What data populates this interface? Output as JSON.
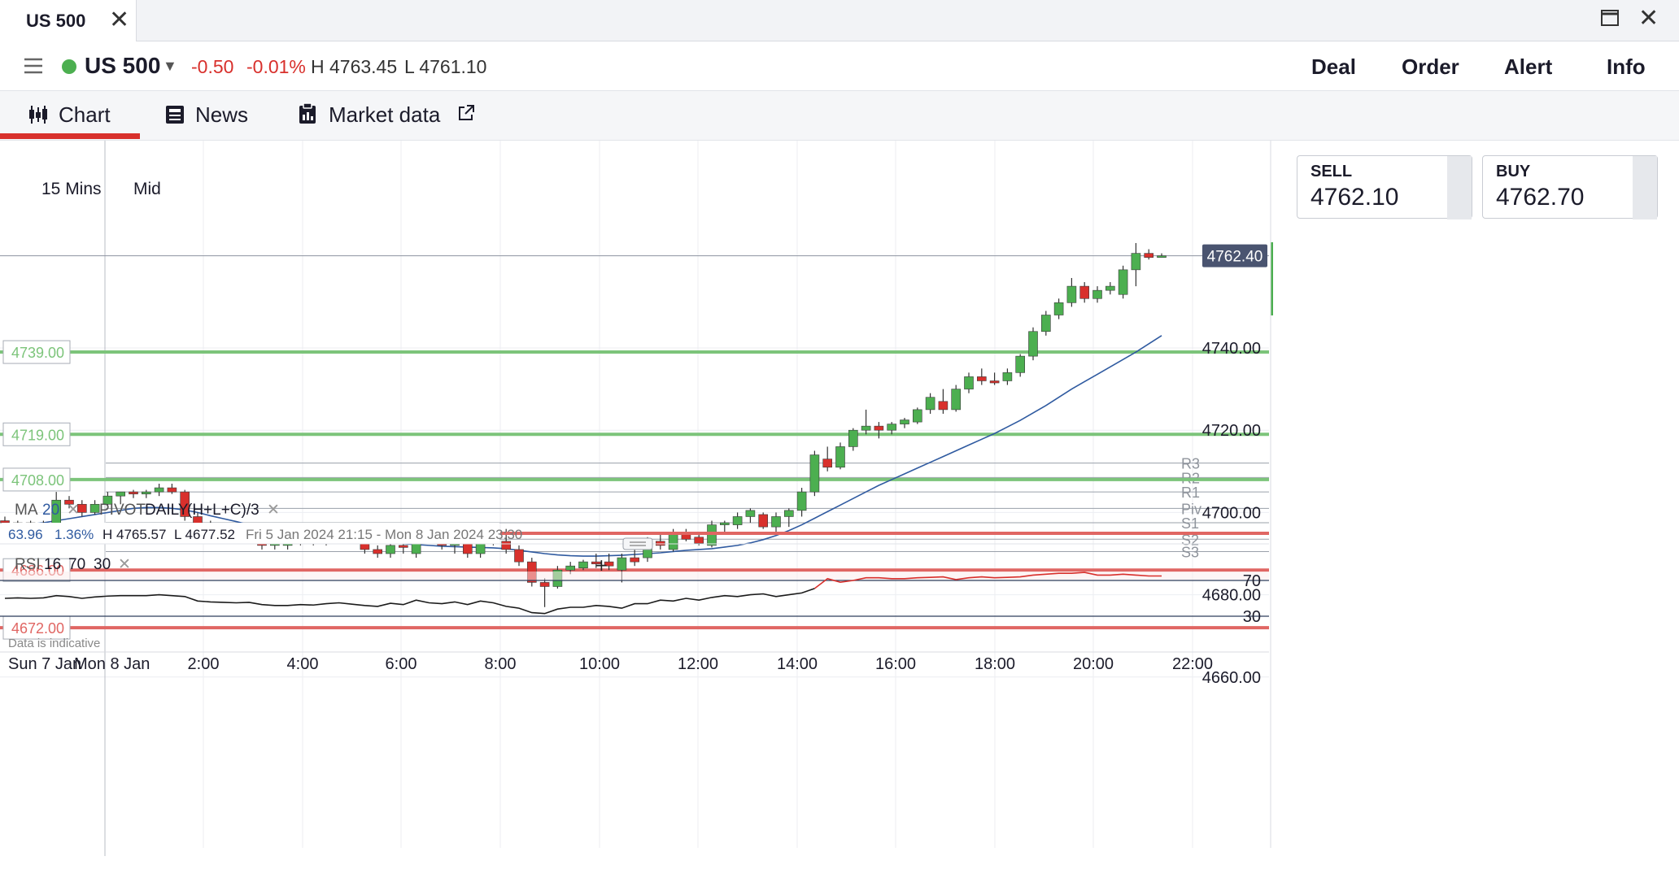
{
  "window": {
    "tab_title": "US 500"
  },
  "header": {
    "symbol": "US 500",
    "change": "-0.50",
    "change_pct": "-0.01%",
    "high": "H 4763.45",
    "low": "L 4761.10",
    "buttons": [
      "Deal",
      "Order",
      "Alert",
      "Info"
    ]
  },
  "subtabs": {
    "chart": "Chart",
    "news": "News",
    "market_data": "Market data"
  },
  "timeframe": {
    "interval": "15 Mins",
    "price_type": "Mid"
  },
  "quote": {
    "sell_label": "SELL",
    "sell": "4762.10",
    "buy_label": "BUY",
    "buy": "4762.70"
  },
  "colors": {
    "up": "#4caf50",
    "down": "#d8302c",
    "ma": "#2f5aa0",
    "last_price_bg": "#4a5470",
    "green_level": "#7cc47a",
    "red_level": "#e06663",
    "status_dot": "#4caf50"
  },
  "chart_data": {
    "type": "candlestick",
    "last_price": 4762.4,
    "last_price_label": "4762.40",
    "ylim": [
      4651,
      4776
    ],
    "y_ticks": [
      4740,
      4720,
      4700,
      4680,
      4660
    ],
    "y_tick_labels": [
      "4740.00",
      "4720.00",
      "4700.00",
      "4680.00",
      "4660.00"
    ],
    "x_tick_labels": [
      "2:00",
      "4:00",
      "6:00",
      "8:00",
      "10:00",
      "12:00",
      "14:00",
      "16:00",
      "18:00",
      "20:00",
      "22:00"
    ],
    "x_date_labels": [
      "Sun 7 Jan",
      "Mon 8 Jan"
    ],
    "level_lines": [
      {
        "label": "4739.00",
        "value": 4739,
        "kind": "resistance"
      },
      {
        "label": "4719.00",
        "value": 4719,
        "kind": "resistance"
      },
      {
        "label": "4708.00",
        "value": 4708,
        "kind": "resistance"
      },
      {
        "label": "4686.00",
        "value": 4686,
        "kind": "support"
      },
      {
        "label": "4672.00",
        "value": 4672,
        "kind": "support"
      }
    ],
    "pivots": [
      {
        "label": "R3",
        "value": 4712
      },
      {
        "label": "R2",
        "value": 4708.5
      },
      {
        "label": "R1",
        "value": 4705
      },
      {
        "label": "Piv",
        "value": 4701
      },
      {
        "label": "S1",
        "value": 4697.5
      },
      {
        "label": "S2",
        "value": 4693.5
      },
      {
        "label": "S3",
        "value": 4690.5
      }
    ],
    "candles": [
      {
        "t": "00:00",
        "o": 4698,
        "h": 4699,
        "l": 4697,
        "c": 4697.5
      },
      {
        "t": "00:15",
        "o": 4697.5,
        "h": 4698,
        "l": 4696,
        "c": 4696.5
      },
      {
        "t": "00:30",
        "o": 4697,
        "h": 4698,
        "l": 4696,
        "c": 4697.5
      },
      {
        "t": "00:45",
        "o": 4697,
        "h": 4698,
        "l": 4696.5,
        "c": 4697
      },
      {
        "t": "01:00",
        "o": 4697,
        "h": 4705,
        "l": 4696,
        "c": 4703
      },
      {
        "t": "01:15",
        "o": 4703,
        "h": 4704,
        "l": 4701,
        "c": 4702
      },
      {
        "t": "01:30",
        "o": 4702,
        "h": 4703,
        "l": 4699,
        "c": 4700
      },
      {
        "t": "01:45",
        "o": 4700,
        "h": 4703,
        "l": 4699.5,
        "c": 4702
      },
      {
        "t": "02:00",
        "o": 4702,
        "h": 4705,
        "l": 4701,
        "c": 4704
      },
      {
        "t": "02:15",
        "o": 4704,
        "h": 4705,
        "l": 4702,
        "c": 4705
      },
      {
        "t": "02:30",
        "o": 4705,
        "h": 4705.5,
        "l": 4703.5,
        "c": 4704.5
      },
      {
        "t": "02:45",
        "o": 4704.5,
        "h": 4705.5,
        "l": 4703.5,
        "c": 4705
      },
      {
        "t": "03:00",
        "o": 4705,
        "h": 4707,
        "l": 4704,
        "c": 4706
      },
      {
        "t": "03:15",
        "o": 4706,
        "h": 4707,
        "l": 4704.5,
        "c": 4705
      },
      {
        "t": "03:30",
        "o": 4705,
        "h": 4705.5,
        "l": 4698,
        "c": 4699
      },
      {
        "t": "03:45",
        "o": 4699,
        "h": 4700,
        "l": 4696,
        "c": 4697
      },
      {
        "t": "04:00",
        "o": 4697,
        "h": 4698,
        "l": 4695,
        "c": 4696
      },
      {
        "t": "04:15",
        "o": 4696,
        "h": 4697,
        "l": 4695,
        "c": 4696.5
      },
      {
        "t": "04:30",
        "o": 4696,
        "h": 4697,
        "l": 4693,
        "c": 4694
      },
      {
        "t": "04:45",
        "o": 4694,
        "h": 4695,
        "l": 4692.5,
        "c": 4693
      },
      {
        "t": "05:00",
        "o": 4693,
        "h": 4694,
        "l": 4691,
        "c": 4692
      },
      {
        "t": "05:15",
        "o": 4692,
        "h": 4693,
        "l": 4691,
        "c": 4692.5
      },
      {
        "t": "05:30",
        "o": 4692,
        "h": 4693.5,
        "l": 4691,
        "c": 4693
      },
      {
        "t": "05:45",
        "o": 4693,
        "h": 4694,
        "l": 4692,
        "c": 4693.5
      },
      {
        "t": "06:00",
        "o": 4693.5,
        "h": 4694,
        "l": 4692,
        "c": 4692.5
      },
      {
        "t": "06:15",
        "o": 4693,
        "h": 4694.5,
        "l": 4692,
        "c": 4694
      },
      {
        "t": "06:30",
        "o": 4694,
        "h": 4695,
        "l": 4693,
        "c": 4694.5
      },
      {
        "t": "06:45",
        "o": 4694.5,
        "h": 4695,
        "l": 4692.5,
        "c": 4693
      },
      {
        "t": "07:00",
        "o": 4693,
        "h": 4694,
        "l": 4690,
        "c": 4691
      },
      {
        "t": "07:15",
        "o": 4691,
        "h": 4692,
        "l": 4689,
        "c": 4690
      },
      {
        "t": "07:30",
        "o": 4690,
        "h": 4693,
        "l": 4689,
        "c": 4692
      },
      {
        "t": "07:45",
        "o": 4692,
        "h": 4693,
        "l": 4690,
        "c": 4691.5
      },
      {
        "t": "08:00",
        "o": 4690,
        "h": 4696,
        "l": 4689,
        "c": 4695
      },
      {
        "t": "08:15",
        "o": 4695,
        "h": 4696,
        "l": 4693,
        "c": 4694
      },
      {
        "t": "08:30",
        "o": 4694,
        "h": 4695,
        "l": 4691,
        "c": 4692
      },
      {
        "t": "08:45",
        "o": 4692,
        "h": 4694,
        "l": 4690,
        "c": 4693
      },
      {
        "t": "09:00",
        "o": 4693,
        "h": 4694,
        "l": 4689,
        "c": 4690
      },
      {
        "t": "09:15",
        "o": 4690,
        "h": 4695.5,
        "l": 4689,
        "c": 4695
      },
      {
        "t": "09:30",
        "o": 4695,
        "h": 4697,
        "l": 4692,
        "c": 4693
      },
      {
        "t": "09:45",
        "o": 4693,
        "h": 4696,
        "l": 4690,
        "c": 4691
      },
      {
        "t": "10:00",
        "o": 4691,
        "h": 4692,
        "l": 4687,
        "c": 4688
      },
      {
        "t": "10:15",
        "o": 4688,
        "h": 4689,
        "l": 4682,
        "c": 4683
      },
      {
        "t": "10:30",
        "o": 4683,
        "h": 4684,
        "l": 4677,
        "c": 4682
      },
      {
        "t": "10:45",
        "o": 4682,
        "h": 4687,
        "l": 4681.5,
        "c": 4686
      },
      {
        "t": "11:00",
        "o": 4686,
        "h": 4688,
        "l": 4685,
        "c": 4687
      },
      {
        "t": "11:15",
        "o": 4686.5,
        "h": 4688.5,
        "l": 4686,
        "c": 4688
      },
      {
        "t": "11:30",
        "o": 4688,
        "h": 4690,
        "l": 4686.5,
        "c": 4687.5
      },
      {
        "t": "11:45",
        "o": 4688,
        "h": 4690,
        "l": 4686,
        "c": 4687
      },
      {
        "t": "12:00",
        "o": 4686,
        "h": 4690,
        "l": 4683,
        "c": 4689
      },
      {
        "t": "12:15",
        "o": 4689,
        "h": 4691,
        "l": 4687,
        "c": 4688
      },
      {
        "t": "12:30",
        "o": 4689,
        "h": 4694,
        "l": 4688,
        "c": 4693
      },
      {
        "t": "12:45",
        "o": 4693,
        "h": 4695,
        "l": 4691,
        "c": 4692
      },
      {
        "t": "13:00",
        "o": 4691,
        "h": 4696,
        "l": 4690.5,
        "c": 4695
      },
      {
        "t": "13:15",
        "o": 4695,
        "h": 4696,
        "l": 4693,
        "c": 4693.5
      },
      {
        "t": "13:30",
        "o": 4694,
        "h": 4695,
        "l": 4692,
        "c": 4692.5
      },
      {
        "t": "13:45",
        "o": 4692,
        "h": 4698,
        "l": 4691.5,
        "c": 4697
      },
      {
        "t": "14:00",
        "o": 4697,
        "h": 4698,
        "l": 4695,
        "c": 4697.5
      },
      {
        "t": "14:15",
        "o": 4697,
        "h": 4700,
        "l": 4696,
        "c": 4699
      },
      {
        "t": "14:30",
        "o": 4699,
        "h": 4701,
        "l": 4697.5,
        "c": 4700.5
      },
      {
        "t": "14:45",
        "o": 4699.5,
        "h": 4700,
        "l": 4696,
        "c": 4696.5
      },
      {
        "t": "15:00",
        "o": 4696.5,
        "h": 4700,
        "l": 4695,
        "c": 4699
      },
      {
        "t": "15:15",
        "o": 4699,
        "h": 4701,
        "l": 4696.5,
        "c": 4700.5
      },
      {
        "t": "15:30",
        "o": 4700.5,
        "h": 4706,
        "l": 4699,
        "c": 4705
      },
      {
        "t": "15:45",
        "o": 4705,
        "h": 4715,
        "l": 4704,
        "c": 4714
      },
      {
        "t": "16:00",
        "o": 4713,
        "h": 4716,
        "l": 4710,
        "c": 4711
      },
      {
        "t": "16:15",
        "o": 4711,
        "h": 4717,
        "l": 4710.5,
        "c": 4716
      },
      {
        "t": "16:30",
        "o": 4716,
        "h": 4720.5,
        "l": 4715,
        "c": 4720
      },
      {
        "t": "16:45",
        "o": 4720,
        "h": 4725,
        "l": 4719,
        "c": 4721
      },
      {
        "t": "17:00",
        "o": 4721,
        "h": 4722,
        "l": 4718,
        "c": 4720
      },
      {
        "t": "17:15",
        "o": 4720,
        "h": 4722,
        "l": 4719,
        "c": 4721.5
      },
      {
        "t": "17:30",
        "o": 4721.5,
        "h": 4723,
        "l": 4720.5,
        "c": 4722.5
      },
      {
        "t": "17:45",
        "o": 4722,
        "h": 4725.5,
        "l": 4721.5,
        "c": 4725
      },
      {
        "t": "18:00",
        "o": 4725,
        "h": 4729,
        "l": 4724,
        "c": 4728
      },
      {
        "t": "18:15",
        "o": 4727,
        "h": 4730,
        "l": 4724,
        "c": 4725
      },
      {
        "t": "18:30",
        "o": 4725,
        "h": 4731,
        "l": 4724.5,
        "c": 4730
      },
      {
        "t": "18:45",
        "o": 4730,
        "h": 4734,
        "l": 4729,
        "c": 4733
      },
      {
        "t": "19:00",
        "o": 4733,
        "h": 4735,
        "l": 4731,
        "c": 4732
      },
      {
        "t": "19:15",
        "o": 4732,
        "h": 4734,
        "l": 4731,
        "c": 4731.5
      },
      {
        "t": "19:30",
        "o": 4732,
        "h": 4735,
        "l": 4731,
        "c": 4734
      },
      {
        "t": "19:45",
        "o": 4734,
        "h": 4738.5,
        "l": 4733,
        "c": 4738
      },
      {
        "t": "20:00",
        "o": 4738,
        "h": 4745,
        "l": 4737,
        "c": 4744
      },
      {
        "t": "20:15",
        "o": 4744,
        "h": 4749,
        "l": 4743,
        "c": 4748
      },
      {
        "t": "20:30",
        "o": 4748,
        "h": 4752,
        "l": 4747,
        "c": 4751
      },
      {
        "t": "20:45",
        "o": 4751,
        "h": 4757,
        "l": 4750,
        "c": 4755
      },
      {
        "t": "21:00",
        "o": 4755,
        "h": 4756,
        "l": 4751,
        "c": 4752
      },
      {
        "t": "21:15",
        "o": 4752,
        "h": 4755,
        "l": 4751,
        "c": 4754
      },
      {
        "t": "21:30",
        "o": 4754,
        "h": 4756,
        "l": 4753,
        "c": 4755
      },
      {
        "t": "21:45",
        "o": 4753,
        "h": 4760,
        "l": 4752,
        "c": 4759
      },
      {
        "t": "22:00",
        "o": 4759,
        "h": 4765.5,
        "l": 4755,
        "c": 4763
      },
      {
        "t": "22:15",
        "o": 4763,
        "h": 4764,
        "l": 4761.5,
        "c": 4762
      },
      {
        "t": "22:30",
        "o": 4762,
        "h": 4763,
        "l": 4762,
        "c": 4762.4
      }
    ],
    "ma_20": [
      4697,
      4697,
      4697.2,
      4697.5,
      4698,
      4698.5,
      4699,
      4699.5,
      4700,
      4700.5,
      4701,
      4701.2,
      4701.2,
      4701,
      4700.6,
      4700,
      4699.2,
      4698.5,
      4697.8,
      4697,
      4696.4,
      4695.8,
      4695.2,
      4694.6,
      4694.2,
      4693.8,
      4693.5,
      4693.2,
      4693,
      4692.8,
      4692.6,
      4692.4,
      4692.2,
      4692,
      4691.8,
      4691.7,
      4691.6,
      4691.5,
      4691.4,
      4691.2,
      4690.8,
      4690.4,
      4690,
      4689.7,
      4689.5,
      4689.4,
      4689.4,
      4689.5,
      4689.6,
      4689.8,
      4690,
      4690.2,
      4690.5,
      4690.8,
      4691,
      4691.2,
      4691.6,
      4692,
      4692.6,
      4693.4,
      4694.4,
      4695.6,
      4697,
      4698.6,
      4700.2,
      4701.8,
      4703.4,
      4705,
      4706.6,
      4708,
      4709.4,
      4710.8,
      4712.2,
      4713.6,
      4715,
      4716.4,
      4717.8,
      4719.2,
      4720.8,
      4722.4,
      4724.2,
      4726,
      4728,
      4730,
      4731.8,
      4733.6,
      4735.4,
      4737.2,
      4739,
      4741,
      4743
    ],
    "indicators": {
      "ma_label": "MA",
      "ma_period": "20",
      "pivot_label": "PIVOT",
      "pivot_period": "DAILY",
      "pivot_formula": "(H+L+C)/3",
      "range_change": "63.96",
      "range_change_pct": "1.36%",
      "range_high": "H 4765.57",
      "range_low": "L 4677.52",
      "range_dates": "Fri 5 Jan 2024 21:15 - Mon 8 Jan 2024 23:30"
    },
    "rsi": {
      "label": "RSI",
      "period": "16",
      "upper": "70",
      "lower": "30",
      "levels": [
        70,
        30
      ],
      "level_labels": [
        "70",
        "30"
      ],
      "values": [
        50,
        50.5,
        50,
        50.5,
        53,
        52,
        50,
        51.5,
        52.5,
        53,
        53,
        53,
        54,
        53,
        52,
        47,
        46,
        45.5,
        45,
        45.5,
        43,
        42,
        42,
        43,
        42.5,
        44,
        45,
        43.5,
        42,
        41,
        44.5,
        43,
        48,
        45,
        44,
        46,
        43,
        47,
        45,
        41,
        39,
        34,
        33,
        38,
        40,
        40,
        42,
        41,
        39,
        44,
        44,
        48,
        47,
        50,
        48,
        51,
        53,
        52,
        54,
        55,
        52,
        54,
        56,
        61,
        72,
        68,
        70,
        73,
        73,
        72,
        72,
        73,
        73.5,
        74,
        71,
        73,
        74,
        73,
        73.5,
        74,
        76,
        77,
        78,
        78,
        79,
        76,
        76,
        77,
        76,
        75,
        75
      ]
    },
    "footnote": "Data is indicative"
  }
}
